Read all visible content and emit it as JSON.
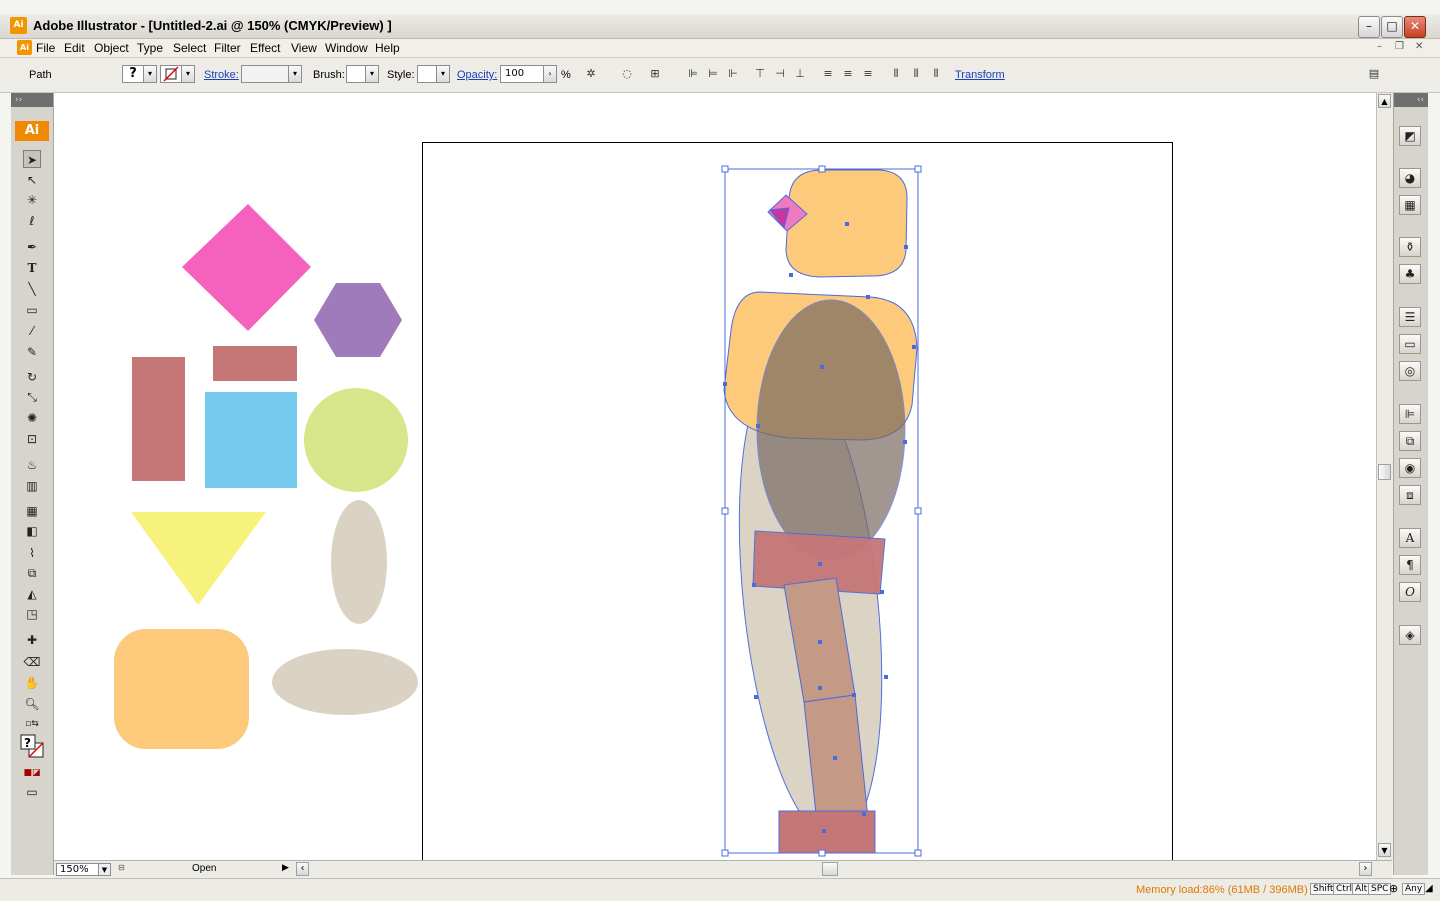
{
  "window": {
    "title": "Adobe Illustrator - [Untitled-2.ai @ 150% (CMYK/Preview) ]",
    "app_icon": "Ai",
    "buttons": [
      "minimize-icon",
      "maximize-icon",
      "close-icon"
    ]
  },
  "menubar": {
    "items": [
      "File",
      "Edit",
      "Object",
      "Type",
      "Select",
      "Filter",
      "Effect",
      "View",
      "Window",
      "Help"
    ]
  },
  "control": {
    "selection_type": "Path",
    "fill_value": "?",
    "stroke_label": "Stroke:",
    "brush_label": "Brush:",
    "style_label": "Style:",
    "opacity_label": "Opacity:",
    "opacity_value": "100",
    "opacity_unit": "%",
    "transform_label": "Transform"
  },
  "toolbox": {
    "logo": "Ai",
    "tools": [
      "selection-tool-icon",
      "direct-selection-tool-icon",
      "magic-wand-icon",
      "lasso-icon",
      "pen-icon",
      "type-icon",
      "line-icon",
      "rectangle-icon",
      "paintbrush-icon",
      "pencil-icon",
      "rotate-icon",
      "scale-icon",
      "warp-icon",
      "free-transform-icon",
      "symbol-sprayer-icon",
      "graph-icon",
      "mesh-icon",
      "gradient-icon",
      "eyedropper-icon",
      "blend-icon",
      "live-paint-icon",
      "live-paint-select-icon",
      "slice-icon",
      "eraser-icon",
      "hand-icon",
      "zoom-icon"
    ]
  },
  "statusbar": {
    "zoom": "150%",
    "status": "Open",
    "memory": "Memory load:86% (61MB / 396MB)",
    "keys": [
      "Shift",
      "Ctrl",
      "Alt",
      "SPC",
      "Any"
    ]
  },
  "colors": {
    "pink": "#f462bd",
    "purple": "#a07bbb",
    "rose": "#c57778",
    "sky": "#75c9ec",
    "lime": "#d7e68a",
    "yellow": "#f7f27c",
    "taupe": "#dad3c4",
    "peach": "#fdc97b",
    "selection": "#4a6be0"
  }
}
